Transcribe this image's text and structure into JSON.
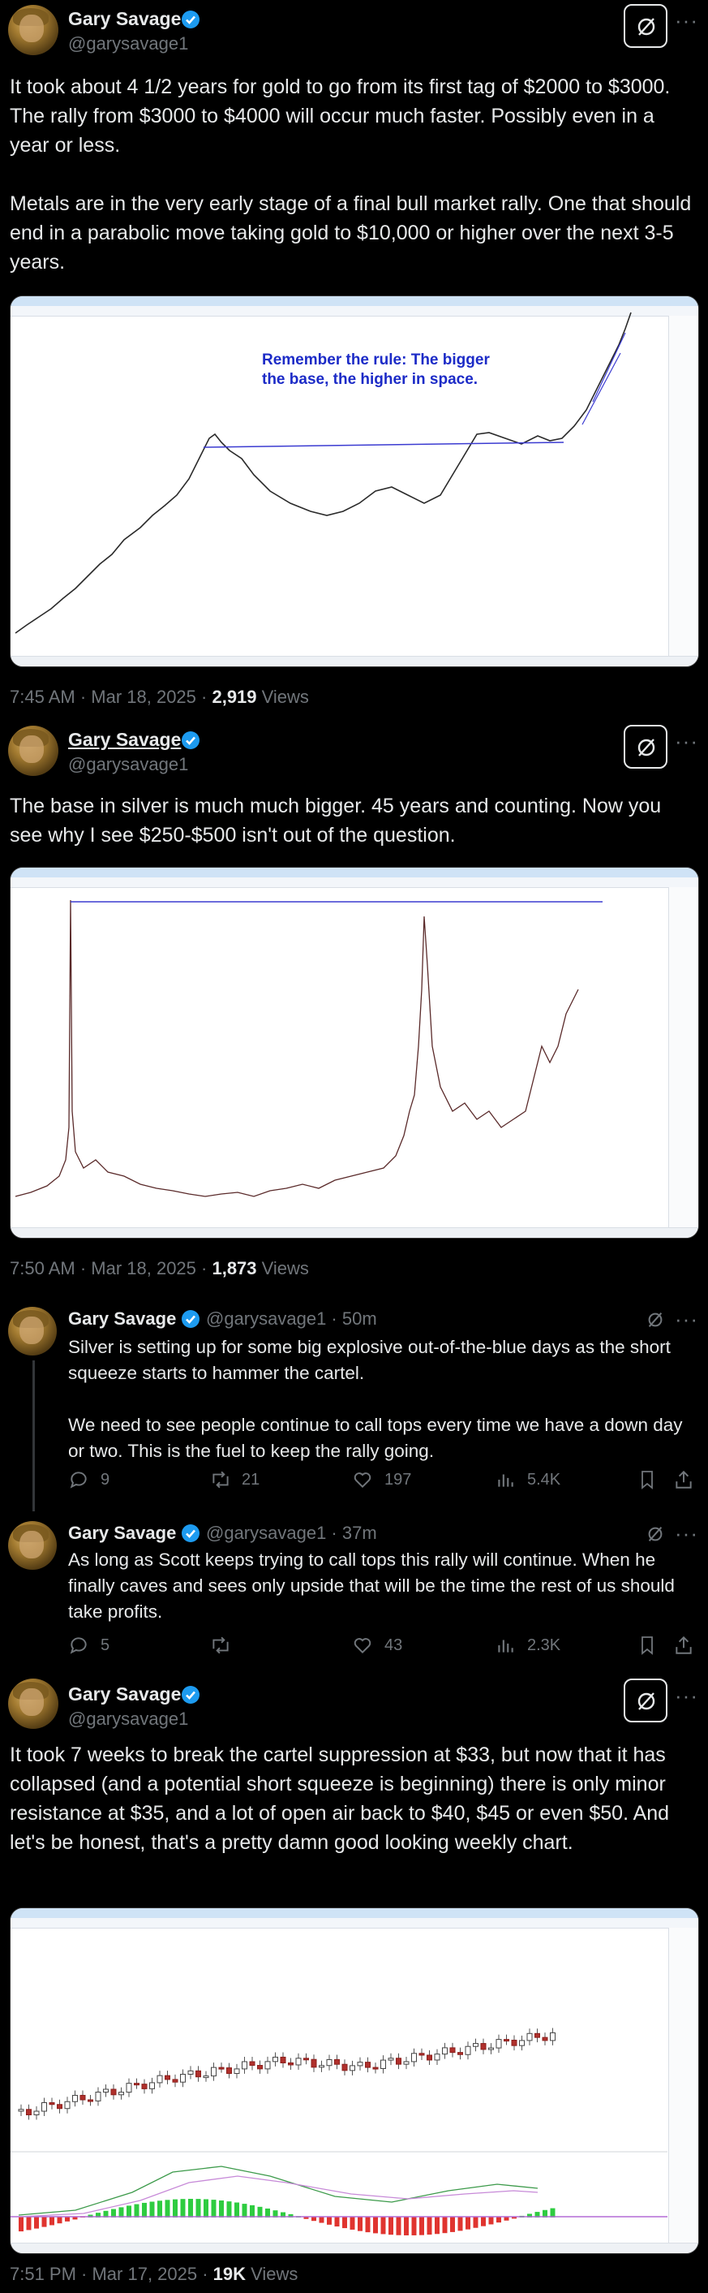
{
  "post1": {
    "author_name": "Gary Savage",
    "author_handle": "@garysavage1",
    "body": "It took about 4 1/2 years for gold to go from its first tag of $2000 to $3000. The rally from $3000 to $4000 will occur much faster. Possibly even in a year or less.\n\nMetals are in the very early stage of a final bull market rally. One that should end in a parabolic move taking gold to $10,000 or higher over the next 3-5 years.",
    "chart": {
      "annotation_line1": "Remember the rule: The bigger",
      "annotation_line2": "the base, the higher in space."
    },
    "time": "7:45 AM · Mar 18, 2025 · ",
    "views_count": "2,919",
    "views_label": " Views"
  },
  "post2": {
    "author_name": "Gary Savage",
    "author_handle": "@garysavage1",
    "body": "The base in silver is much much bigger. 45 years and counting. Now you see why I see $250-$500 isn't out of the question.",
    "time": "7:50 AM · Mar 18, 2025 · ",
    "views_count": "1,873",
    "views_label": " Views"
  },
  "reply1": {
    "author_name": "Gary Savage",
    "author_handle": "@garysavage1 · 50m",
    "body": "Silver is setting up for some big explosive out-of-the-blue days as the short squeeze starts to hammer the cartel.\n\nWe need to see people continue to call tops every time we have a down day or two. This is the fuel to keep the rally going.",
    "replies": "9",
    "reposts": "21",
    "likes": "197",
    "views": "5.4K"
  },
  "reply2": {
    "author_name": "Gary Savage",
    "author_handle": "@garysavage1 · 37m",
    "body": "As long as Scott keeps trying to call tops this rally will continue. When he finally caves and sees only upside that will be the time the rest of us should take profits.",
    "replies": "5",
    "reposts": "",
    "likes": "43",
    "views": "2.3K"
  },
  "post3": {
    "author_name": "Gary Savage",
    "author_handle": "@garysavage1",
    "body": "It took 7 weeks to break the cartel suppression at $33, but now that it has collapsed (and a potential short squeeze is beginning) there is only minor resistance at $35, and a lot of open air back to $40, $45 or even $50. And let's be honest, that's a pretty damn good looking weekly chart.",
    "time": "7:51 PM · Mar 17, 2025 · ",
    "views_count": "19K",
    "views_label": " Views"
  },
  "colors": {
    "background": "#000000",
    "text": "#e7e9ea",
    "muted": "#71767b",
    "verified": "#1d9bf0",
    "gold_line": "#1a1a1a",
    "base_line": "#3b3bd1"
  },
  "icons": [
    "verified-badge-icon",
    "grok-icon",
    "more-icon",
    "reply-icon",
    "repost-icon",
    "like-icon",
    "views-icon",
    "bookmark-icon",
    "share-icon"
  ]
}
